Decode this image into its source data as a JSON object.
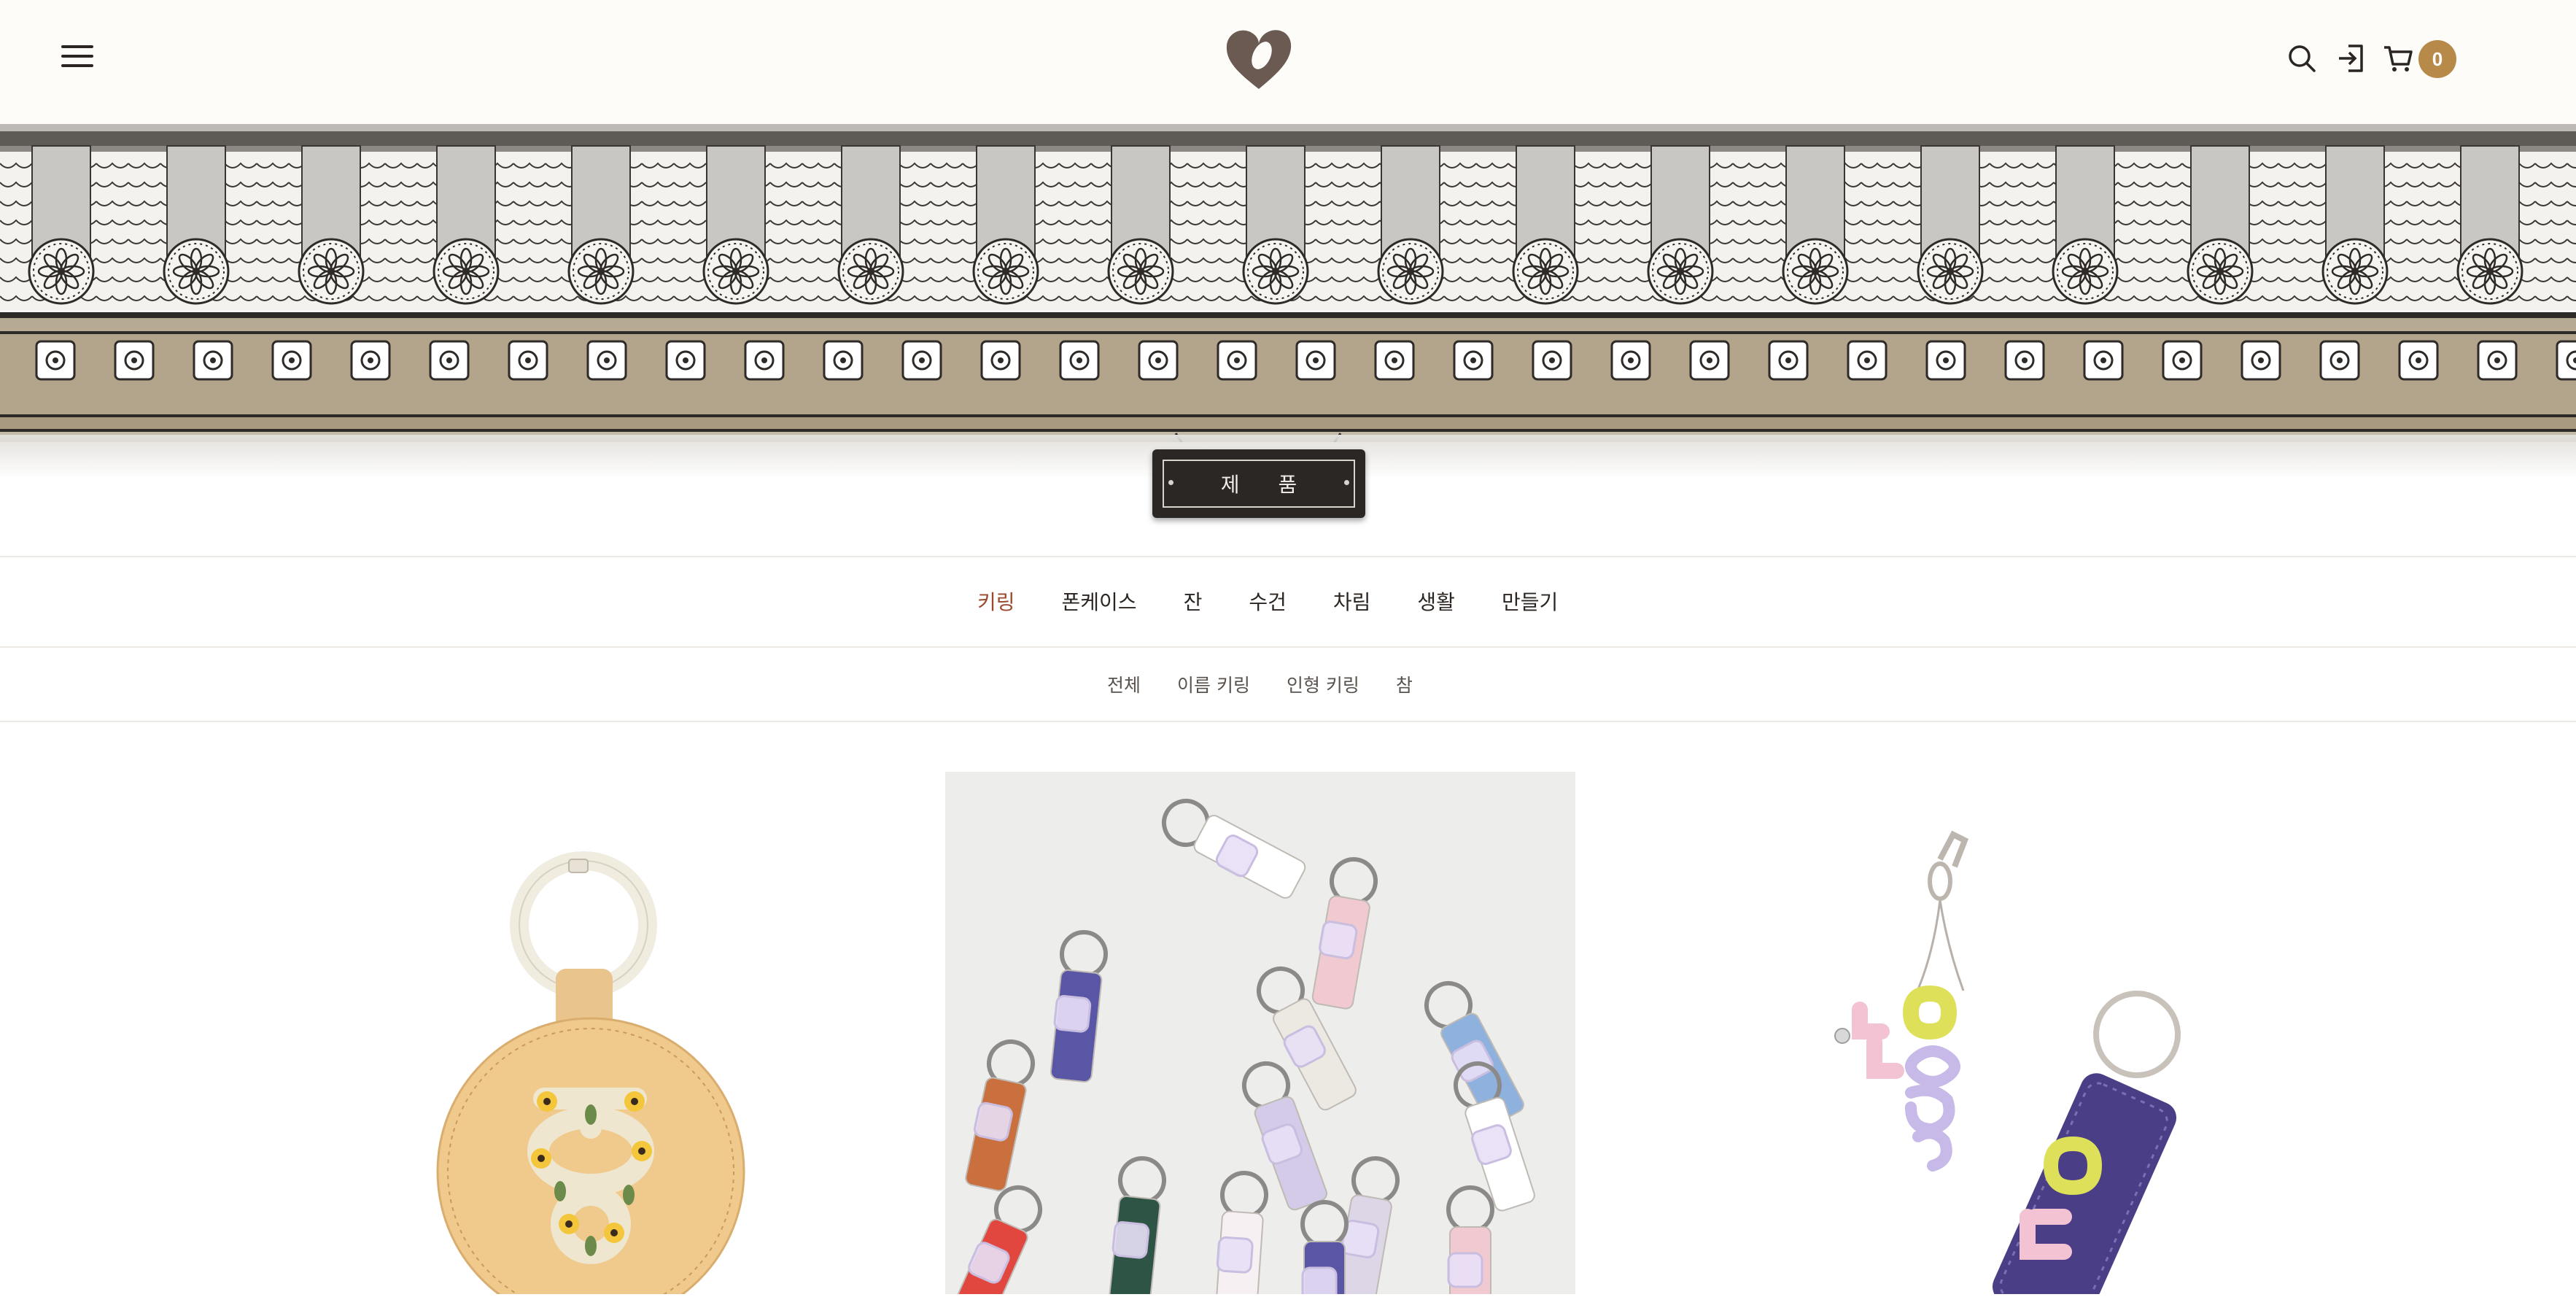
{
  "header": {
    "menu_icon": "hamburger-menu-icon",
    "logo_icon": "heart-knot-logo-icon",
    "icons": [
      "search-icon",
      "login-icon",
      "cart-icon"
    ],
    "cart_count": "0",
    "accent_color": "#b88a4a"
  },
  "banner": {
    "sign_label": "제 품"
  },
  "categories": {
    "active_color": "#9c4a2e",
    "items": [
      {
        "label": "키링"
      },
      {
        "label": "폰케이스"
      },
      {
        "label": "잔"
      },
      {
        "label": "수건"
      },
      {
        "label": "차림"
      },
      {
        "label": "생활"
      },
      {
        "label": "만들기"
      }
    ]
  },
  "subcategories": {
    "items": [
      {
        "label": "전체"
      },
      {
        "label": "이름 키링"
      },
      {
        "label": "인형 키링"
      },
      {
        "label": "참"
      }
    ]
  },
  "products": [
    {
      "icon": "leather-round-keyring-image"
    },
    {
      "icon": "hangul-acrylic-keyrings-image"
    },
    {
      "icon": "navy-leather-keyring-image"
    }
  ]
}
